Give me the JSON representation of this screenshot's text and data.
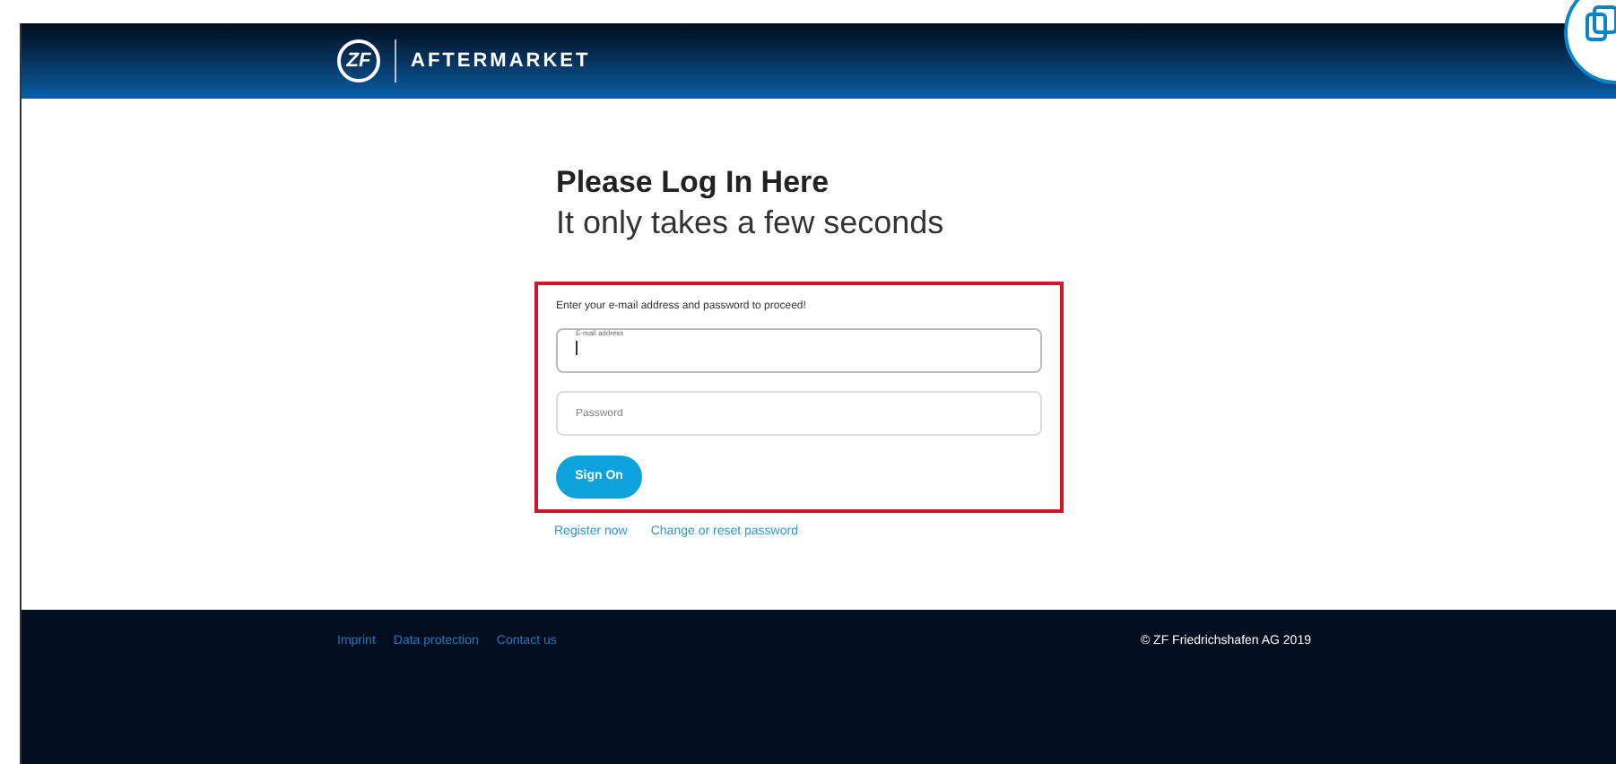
{
  "header": {
    "logo_mark": "ZF",
    "brand": "AFTERMARKET"
  },
  "login": {
    "title": "Please Log In Here",
    "subtitle": "It only takes a few seconds",
    "instruction": "Enter your e-mail address and password to proceed!",
    "fields": [
      {
        "label": "E-mail address",
        "focused": true
      },
      {
        "placeholder": "Password",
        "focused": false
      }
    ],
    "button": "Sign On",
    "links": [
      "Register now",
      "Change or reset password"
    ]
  },
  "footer": {
    "links": [
      "Imprint",
      "Data protection",
      "Contact us"
    ],
    "copyright": "© ZF Friedrichshafen AG 2019"
  }
}
